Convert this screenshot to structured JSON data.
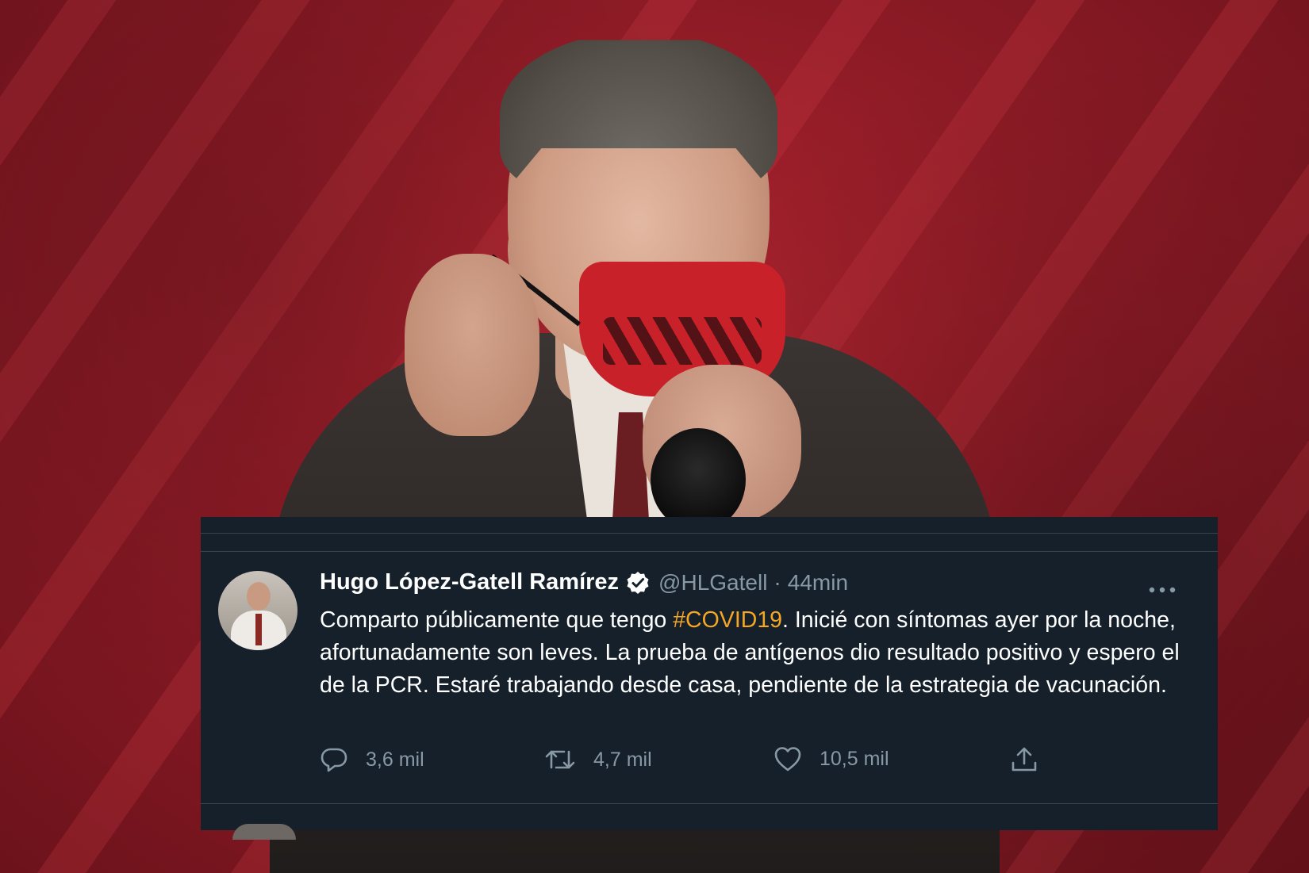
{
  "tweet": {
    "author_name": "Hugo López-Gatell Ramírez",
    "handle": "@HLGatell",
    "separator": "·",
    "time": "44min",
    "text_before_hashtag": "Comparto públicamente que tengo ",
    "hashtag": "#COVID19",
    "text_after_hashtag": ". Inicié con síntomas ayer por la noche, afortunadamente son leves. La prueba de antígenos dio resultado positivo y espero el de la PCR. Estaré trabajando desde casa, pendiente de la estrategia de vacunación.",
    "replies": "3,6 mil",
    "retweets": "4,7 mil",
    "likes": "10,5 mil"
  },
  "icons": {
    "verified": "verified-badge-icon",
    "more": "more-options-icon",
    "reply": "reply-icon",
    "retweet": "retweet-icon",
    "like": "like-heart-icon",
    "share": "share-icon"
  },
  "colors": {
    "background_red": "#9a1f2a",
    "card_background": "#15202b",
    "secondary_text": "#8899a6",
    "hashtag": "#f5a623",
    "divider": "#38444d"
  }
}
